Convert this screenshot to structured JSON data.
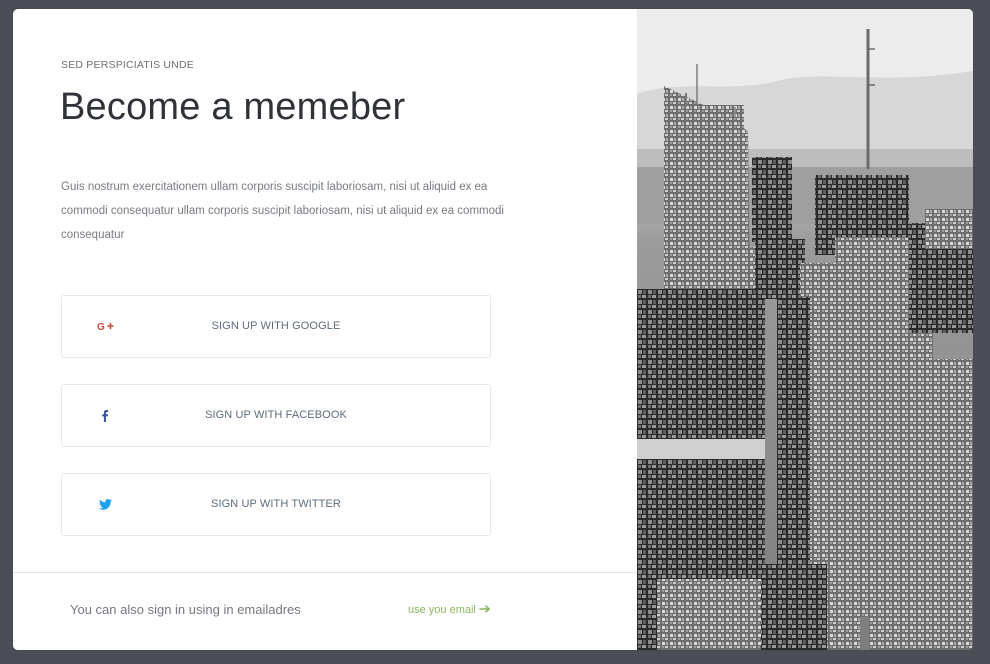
{
  "hero": {
    "eyebrow": "SED PERSPICIATIS UNDE",
    "title": "Become a memeber",
    "description": "Guis nostrum exercitationem ullam corporis suscipit laboriosam, nisi ut aliquid ex ea commodi consequatur ullam corporis suscipit laboriosam, nisi ut aliquid ex ea commodi consequatur"
  },
  "social_buttons": [
    {
      "label": "SIGN UP WITH GOOGLE",
      "icon": "google-plus-icon",
      "color": "#d14836"
    },
    {
      "label": "SIGN UP WITH FACEBOOK",
      "icon": "facebook-icon",
      "color": "#3b5998"
    },
    {
      "label": "SIGN UP WITH TWITTER",
      "icon": "twitter-icon",
      "color": "#1da1f2"
    }
  ],
  "footer": {
    "text": "You can also sign in using in emailadres",
    "link_label": "use you email",
    "link_color": "#8ab55d",
    "link_icon": "arrow-right-icon"
  },
  "colors": {
    "backdrop": "#4b4e57",
    "card": "#ffffff"
  },
  "photo": {
    "icon": "city-skyline-image"
  }
}
